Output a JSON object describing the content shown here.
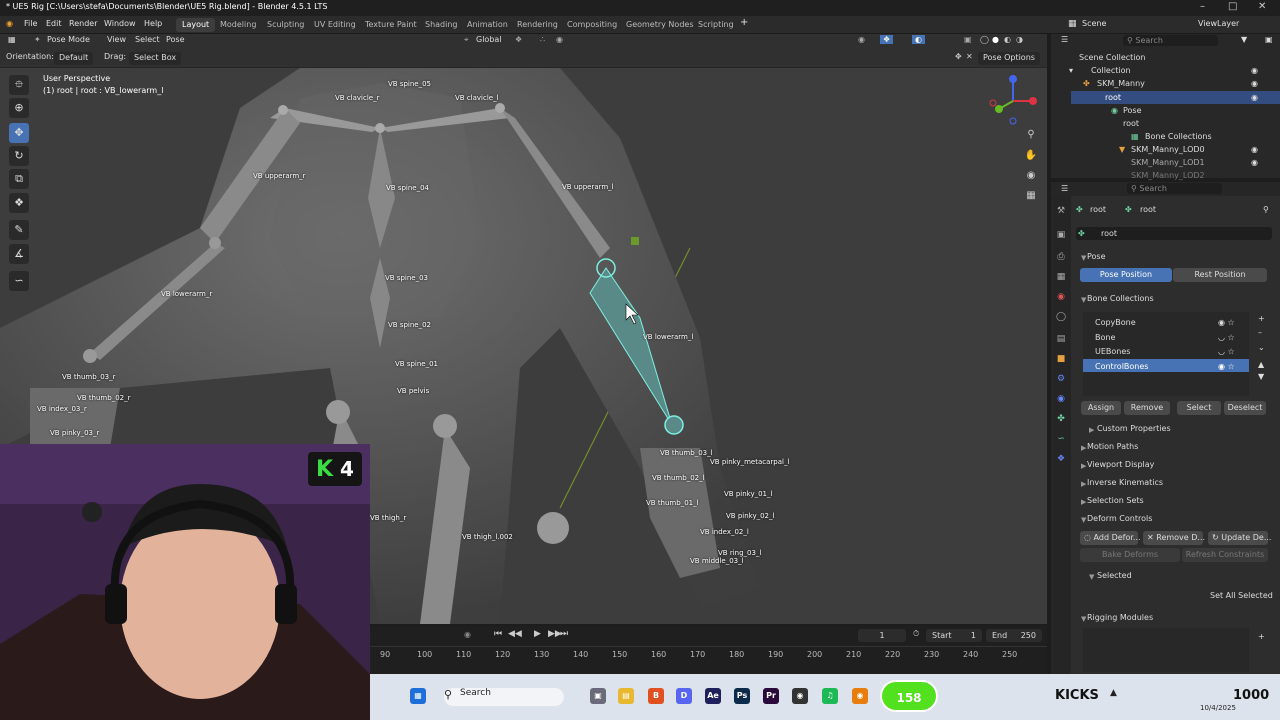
{
  "window": {
    "title": "* UE5 Rig [C:\\Users\\stefa\\Documents\\Blender\\UE5 Rig.blend] - Blender 4.5.1 LTS"
  },
  "menu": [
    "File",
    "Edit",
    "Render",
    "Window",
    "Help"
  ],
  "workspaces": [
    "Layout",
    "Modeling",
    "Sculpting",
    "UV Editing",
    "Texture Paint",
    "Shading",
    "Animation",
    "Rendering",
    "Compositing",
    "Geometry Nodes",
    "Scripting"
  ],
  "header": {
    "mode": "Pose Mode",
    "view": "View",
    "select": "Select",
    "pose": "Pose",
    "transform": "Global",
    "pose_options": "Pose Options"
  },
  "toolsettings": {
    "orientation_label": "Orientation:",
    "orientation": "Default",
    "drag_label": "Drag:",
    "drag": "Select Box"
  },
  "viewport": {
    "perspective": "User Perspective",
    "active": "(1) root | root : VB_lowerarm_l"
  },
  "bones": [
    "VB clavicle_r",
    "VB spine_05",
    "VB clavicle_l",
    "VB upperarm_r",
    "VB spine_04",
    "VB upperarm_l",
    "VB spine_03",
    "VB lowerarm_r",
    "VB spine_02",
    "VB lowerarm_l",
    "VB spine_01",
    "VB pelvis",
    "VB thumb_03_r",
    "VB thumb_02_r",
    "VB index_03_r",
    "VB pinky_03_r",
    "VB thumb_03_l",
    "VB pinky_metacarpal_l",
    "VB thumb_02_l",
    "VB thumb_01_l",
    "VB thigh_l.002",
    "VB pinky_01_l",
    "VB pinky_02_l",
    "VB ring_03_l",
    "VB middle_03_l",
    "VB index_02_l",
    "VB thigh_r"
  ],
  "stream": {
    "badge": "4"
  },
  "timeline": {
    "ticks": [
      "90",
      "100",
      "110",
      "120",
      "130",
      "140",
      "150",
      "160",
      "170",
      "180",
      "190",
      "200",
      "210",
      "220",
      "230",
      "240",
      "250"
    ],
    "current_frame": "1",
    "start_label": "Start",
    "start": "1",
    "end_label": "End",
    "end": "250"
  },
  "outliner": {
    "scene": "Scene",
    "view_layer": "ViewLayer",
    "search": "Search",
    "items": [
      "Scene Collection",
      "Collection",
      "SKM_Manny",
      "root",
      "Pose",
      "root",
      "Bone Collections",
      "SKM_Manny_LOD0",
      "SKM_Manny_LOD1",
      "SKM_Manny_LOD2"
    ]
  },
  "properties": {
    "search": "Search",
    "breadcrumb1": "root",
    "breadcrumb2": "root",
    "name": "root",
    "pose_section": "Pose",
    "pose_position": "Pose Position",
    "rest_position": "Rest Position",
    "bone_collections_section": "Bone Collections",
    "collections": [
      "CopyBone",
      "Bone",
      "UEBones",
      "ControlBones"
    ],
    "assign": "Assign",
    "remove": "Remove",
    "select": "Select",
    "deselect": "Deselect",
    "sections": [
      "Custom Properties",
      "Motion Paths",
      "Viewport Display",
      "Inverse Kinematics",
      "Selection Sets",
      "Deform Controls"
    ],
    "add_deform": "Add Defor...",
    "remove_deform": "Remove D...",
    "update_deform": "Update De...",
    "bake_deforms": "Bake Deforms",
    "refresh_constraints": "Refresh Constraints",
    "selected": "Selected",
    "set_all_selected": "Set All Selected",
    "rigging_modules": "Rigging Modules"
  },
  "taskbar": {
    "search": "Search",
    "kick_count": "158",
    "kicks_label": "KICKS",
    "kicks_value": "1000",
    "date": "10/4/2025"
  },
  "colors": {
    "accent": "#4772b3",
    "kick": "#53e01f"
  }
}
